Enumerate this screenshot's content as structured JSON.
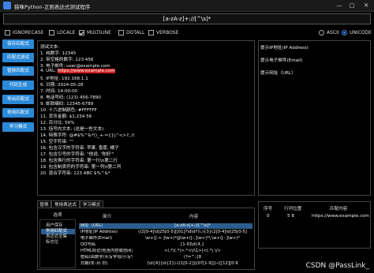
{
  "window": {
    "title": "猫咪Python-正则表达式测试程序",
    "min": "—",
    "max": "□",
    "close": "✕"
  },
  "regex": {
    "value": "[a-zA-z]+://[^\\s]*"
  },
  "flags": [
    {
      "label": "IGNORECASE",
      "checked": false
    },
    {
      "label": "LOCALE",
      "checked": false
    },
    {
      "label": "MULTILINE",
      "checked": true
    },
    {
      "label": "DOTALL",
      "checked": false
    },
    {
      "label": "VERBOSE",
      "checked": false
    }
  ],
  "encoding": [
    {
      "label": "ASCII",
      "checked": false
    },
    {
      "label": "UNICODE",
      "checked": true
    }
  ],
  "sidebar": [
    "保存匹配式",
    "匹配式测试",
    "替换匹配式",
    "代码生成",
    "导出匹配式",
    "常用匹配式",
    "学习模式"
  ],
  "test_text": {
    "lines": [
      "测试文本:",
      "1. 纯数字: 12345",
      "2. 带空格的数字: 123 456",
      "3. 电子邮件: user@example.com",
      "4. URL: ",
      "5. IP地址: 192.168.1.1",
      "6. 日期: 2024-05-28",
      "7. 时间: 14:00:00",
      "8. 电话号码: (123) 456-7890",
      "9. 邮政编码: 12345-6789",
      "10. 十六进制颜色: #FFFFFF",
      "11. 货币金额: $1,234.56",
      "12. 百分比: 50%",
      "13. 括号内文本: (这是一些文本)",
      "14. 特殊字符: @#$%^&*()_+-={}|:\"<>?,./\\",
      "15. 空字符串: \"\"",
      "16. 包含汉字的字符串: 苹果, 香蕉, 橘子",
      "17. 包含引号的字符串: \"他说, '你好'\"",
      "18. 包含换行的字符串: 第一行\\n第二行",
      "19. 包含制表符的字符串: 第一列\\t第二列",
      "20. 混合字符串: 123 ABC $%^&*"
    ],
    "url_match": "https://www.example.com"
  },
  "hints": [
    "提示IP地址(IP Address)",
    "提示电子邮件(Email)",
    "提示网址（URL）"
  ],
  "tabs": [
    "替换",
    "常用表达式",
    "学习模式"
  ],
  "options": {
    "header": "选项",
    "items": [
      "用户保存",
      "常用匹配式",
      "表达式全集",
      "标志位"
    ],
    "selected": 1
  },
  "patterns": {
    "headers": {
      "name": "简介",
      "content": "内容"
    },
    "rows": [
      {
        "name": "网址（URL）",
        "content": "[a-zA-z]+://[^\\s]*",
        "selected": true
      },
      {
        "name": "IP地址(IP Address)",
        "content": "((2[0-4]\\d|25[0-5]|[01]?\\d\\d?)\\.){3}(2[0-4]\\d|25[0-5]",
        "selected": false
      },
      {
        "name": "电子邮件(Email)",
        "content": "\\w+([-+.]\\w+)*@\\w+([-.]\\w+)*\\.\\w+([-.]\\w+)*",
        "selected": false
      },
      {
        "name": "QQ号码",
        "content": "[1-9]\\d{4,}",
        "selected": false
      },
      {
        "name": "HTML标记(包含内容或自闭合)",
        "content": "<(.*)(.*)>.*<\\/\\1>|<(.*) \\/>",
        "selected": false
      },
      {
        "name": "密码(由数字/大写字母/小写字母/标点符",
        "content": "(?=^.{8",
        "selected": false
      },
      {
        "name": "日期(年-月-日)",
        "content": "(\\d{4}|\\d{2})-((1[0-2])|(0?[1-9]))-(([12][0-9",
        "selected": false
      }
    ]
  },
  "matches": {
    "headers": [
      "序号",
      "行列位置",
      "匹配内容"
    ],
    "rows": [
      {
        "index": "0",
        "pos": "5 8",
        "content": "https://www.example.com"
      }
    ]
  },
  "watermark": "CSDN @PassLink_"
}
